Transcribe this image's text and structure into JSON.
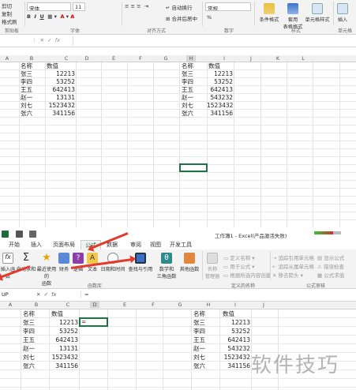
{
  "top_ribbon": {
    "clipboard": {
      "cut": "剪切",
      "copy": "复制",
      "format_painter": "格式刷",
      "group": "剪贴板"
    },
    "font": {
      "name": "宋体",
      "size": "11",
      "group": "字体"
    },
    "alignment": {
      "wrap": "自动换行",
      "merge": "合并后居中",
      "group": "对齐方式"
    },
    "number": {
      "format": "常规",
      "group": "数字",
      "percent": "%"
    },
    "styles": {
      "conditional": "条件格式",
      "table": "套用\n表格格式",
      "cell": "单元格样式",
      "group": "样式"
    },
    "cells": {
      "insert": "插入",
      "group": "单元格"
    }
  },
  "top_formula_bar": {
    "fx": "fx"
  },
  "top_sheet": {
    "columns": [
      "A",
      "B",
      "C",
      "D",
      "E",
      "F",
      "G",
      "H",
      "I",
      "J",
      "K",
      "L"
    ],
    "table1": {
      "header": [
        "名称",
        "数值"
      ],
      "rows": [
        [
          "张三",
          "12213"
        ],
        [
          "李四",
          "53252"
        ],
        [
          "王五",
          "642413"
        ],
        [
          "赵一",
          "13131"
        ],
        [
          "刘七",
          "1523432"
        ],
        [
          "张六",
          "341156"
        ]
      ]
    },
    "table2": {
      "header": [
        "名称",
        "数值"
      ],
      "rows": [
        [
          "张三",
          "12213"
        ],
        [
          "李四",
          "53252"
        ],
        [
          "王五",
          "642413"
        ],
        [
          "赵一",
          "543232"
        ],
        [
          "刘七",
          "1523432"
        ],
        [
          "张六",
          "341156"
        ]
      ]
    }
  },
  "bottom_window": {
    "title": "工作簿1 - Excel(产品激活失败)",
    "tabs": [
      "开始",
      "插入",
      "页面布局",
      "公式",
      "数据",
      "审阅",
      "视图",
      "开发工具"
    ],
    "active_tab": "公式",
    "func_lib": {
      "insert_func": "插入函数",
      "autosum": "自动求和",
      "recent": "最近使用的\n函数",
      "financial": "财务",
      "logical": "逻辑",
      "text": "文本",
      "datetime": "日期和时间",
      "lookup": "查找与引用",
      "math": "数学和\n三角函数",
      "more": "其他函数",
      "group": "函数库"
    },
    "defined_names": {
      "manager": "名称\n管理器",
      "define": "定义名称",
      "use_in_formula": "用于公式",
      "create_from_sel": "根据所选内容创建",
      "group": "定义的名称"
    },
    "auditing": {
      "trace_prec": "追踪引用单元格",
      "trace_dep": "追踪从属单元格",
      "remove_arrows": "移去箭头",
      "show_formulas": "显示公式",
      "error_check": "错误检查",
      "evaluate": "公式求值",
      "group": "公式审核"
    },
    "name_box": "UP",
    "formula": "=",
    "columns": [
      "A",
      "B",
      "C",
      "D",
      "E",
      "F",
      "G",
      "H",
      "I",
      "J"
    ],
    "table1": {
      "header": [
        "名称",
        "数值"
      ],
      "rows": [
        [
          "张三",
          "12213"
        ],
        [
          "李四",
          "53252"
        ],
        [
          "王五",
          "642413"
        ],
        [
          "赵一",
          "13131"
        ],
        [
          "刘七",
          "1523432"
        ],
        [
          "张六",
          "341156"
        ]
      ],
      "active_cell_value": "="
    },
    "table2": {
      "header": [
        "名称",
        "数值"
      ],
      "rows": [
        [
          "张三",
          "12213"
        ],
        [
          "李四",
          "53252"
        ],
        [
          "王五",
          "642413"
        ],
        [
          "赵一",
          "543232"
        ],
        [
          "刘七",
          "1523432"
        ],
        [
          "张六",
          "341156"
        ]
      ]
    }
  },
  "watermark": "软件技巧",
  "colors": {
    "arrow": "#e23b2e",
    "selection": "#217346"
  }
}
